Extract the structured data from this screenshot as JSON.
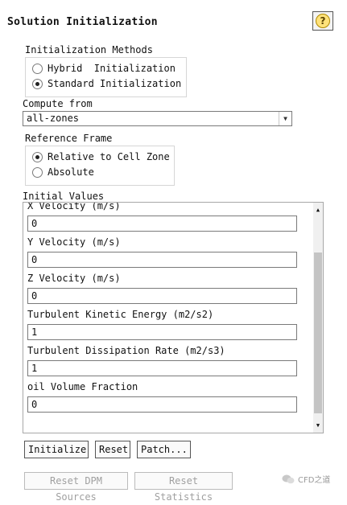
{
  "title": "Solution Initialization",
  "help_icon_glyph": "?",
  "initialization_methods": {
    "label": "Initialization Methods",
    "options": [
      "Hybrid  Initialization",
      "Standard Initialization"
    ],
    "selected": 1
  },
  "compute_from": {
    "label": "Compute from",
    "value": "all-zones"
  },
  "reference_frame": {
    "label": "Reference Frame",
    "options": [
      "Relative to Cell Zone",
      "Absolute"
    ],
    "selected": 0
  },
  "initial_values": {
    "label": "Initial Values",
    "fields": [
      {
        "label": "X Velocity (m/s)",
        "value": "0"
      },
      {
        "label": "Y Velocity (m/s)",
        "value": "0"
      },
      {
        "label": "Z Velocity (m/s)",
        "value": "0"
      },
      {
        "label": "Turbulent Kinetic Energy (m2/s2)",
        "value": "1"
      },
      {
        "label": "Turbulent Dissipation Rate (m2/s3)",
        "value": "1"
      },
      {
        "label": "oil Volume Fraction",
        "value": "0"
      }
    ]
  },
  "buttons": {
    "initialize": "Initialize",
    "reset": "Reset",
    "patch": "Patch...",
    "reset_dpm_sources": "Reset DPM Sources",
    "reset_statistics": "Reset Statistics"
  },
  "watermark": {
    "text": "CFD之道",
    "icon": "wechat-icon"
  }
}
